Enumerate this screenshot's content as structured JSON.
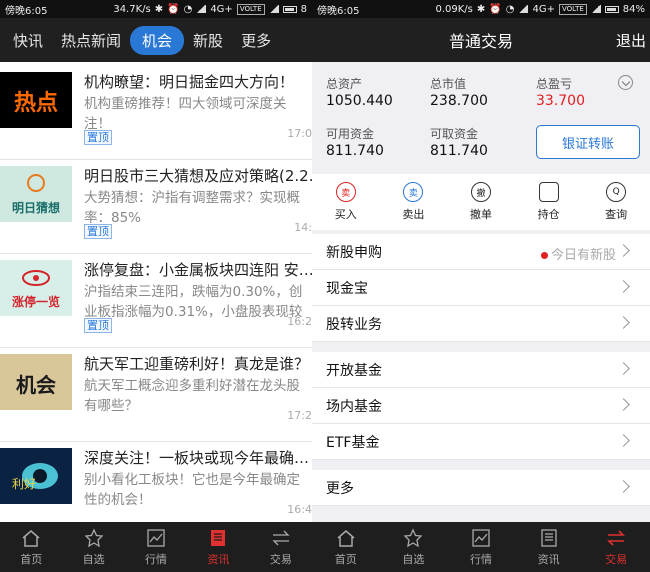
{
  "left": {
    "status": {
      "time": "傍晚6:05",
      "speed": "34.7K/s",
      "net": "4G+",
      "volte": "VOLTE",
      "batt": "8"
    },
    "tabs": [
      "快讯",
      "热点新闻",
      "机会",
      "新股",
      "更多"
    ],
    "news": [
      {
        "title": "机构瞭望：明日掘金四大方向！",
        "desc": "机构重磅推荐！四大领域可深度关注！",
        "pin": "置顶",
        "time": "17:0"
      },
      {
        "title": "明日股市三大猜想及应对策略(2.2.",
        "desc": "大势猜想：沪指有调整需求？实现概率：85%",
        "pin": "置顶",
        "time": "14:"
      },
      {
        "title": "涨停复盘：小金属板块四连阳 安…",
        "desc": "沪指结束三连阳，跌幅为0.30%，创业板指涨幅为0.31%，小盘股表现较好。",
        "pin": "置顶",
        "time": "16:2"
      },
      {
        "title": "航天军工迎重磅利好！真龙是谁？",
        "desc": "航天军工概念迎多重利好潜在龙头股有哪些？",
        "pin": "",
        "time": "17:2"
      },
      {
        "title": "深度关注！一板块或现今年最确…",
        "desc": "别小看化工板块！它也是今年最确定性的机会！",
        "pin": "",
        "time": "16:4"
      }
    ],
    "thumbs": [
      "热点",
      "明日猜想",
      "涨停一览",
      "机会",
      "利好"
    ],
    "nav": [
      "首页",
      "自选",
      "行情",
      "资讯",
      "交易"
    ]
  },
  "right": {
    "status": {
      "time": "傍晚6:05",
      "speed": "0.09K/s",
      "net": "4G+",
      "volte": "VOLTE",
      "batt": "84%"
    },
    "title": "普通交易",
    "logout": "退出",
    "assets": [
      {
        "label": "总资产",
        "value": "1050.440"
      },
      {
        "label": "总市值",
        "value": "238.700"
      },
      {
        "label": "总盈亏",
        "value": "33.700"
      },
      {
        "label": "可用资金",
        "value": "811.740"
      },
      {
        "label": "可取资金",
        "value": "811.740"
      }
    ],
    "bank": "银证转账",
    "actions": [
      "买入",
      "卖出",
      "撤单",
      "持仓",
      "查询"
    ],
    "action_icons": [
      "卖",
      "卖",
      "撤",
      "",
      "Q"
    ],
    "menu1": [
      {
        "label": "新股申购",
        "note": "今日有新股"
      },
      {
        "label": "现金宝",
        "note": ""
      },
      {
        "label": "股转业务",
        "note": ""
      }
    ],
    "menu2": [
      {
        "label": "开放基金"
      },
      {
        "label": "场内基金"
      },
      {
        "label": "ETF基金"
      }
    ],
    "menu3": [
      {
        "label": "更多"
      }
    ],
    "nav": [
      "首页",
      "自选",
      "行情",
      "资讯",
      "交易"
    ],
    "colors": {
      "accent": "#2a78d6",
      "red": "#e02020"
    }
  }
}
